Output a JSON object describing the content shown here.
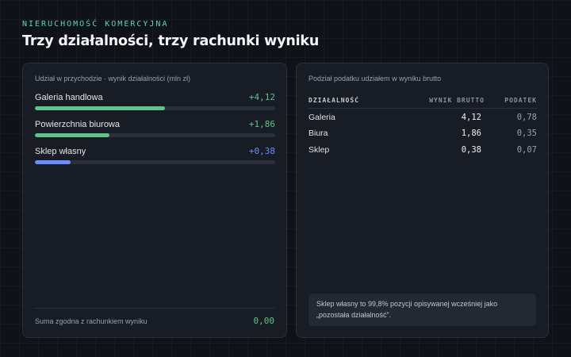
{
  "header": {
    "eyebrow": "NIERUCHOMOŚĆ KOMERCYJNA",
    "title": "Trzy działalności, trzy rachunki wyniku"
  },
  "left_panel": {
    "caption": "Udział w przychodzie · wynik działalności (mln zł)",
    "bars": [
      {
        "label": "Galeria handlowa",
        "value_text": "+4,12",
        "share": 0.54,
        "color": "#5fc48a"
      },
      {
        "label": "Powierzchnia biurowa",
        "value_text": "+1,86",
        "share": 0.31,
        "color": "#5fc48a"
      },
      {
        "label": "Sklep własny",
        "value_text": "+0,38",
        "share": 0.15,
        "color": "#6b8cff"
      }
    ],
    "sum_label": "Suma zgodna z rachunkiem wyniku",
    "sum_value": "0,00"
  },
  "right_panel": {
    "caption": "Podział podatku udziałem w wyniku brutto",
    "columns": [
      "DZIAŁALNOŚĆ",
      "WYNIK BRUTTO",
      "PODATEK"
    ],
    "rows": [
      {
        "name": "Galeria",
        "gross": "4,12",
        "tax": "0,78"
      },
      {
        "name": "Biura",
        "gross": "1,86",
        "tax": "0,35"
      },
      {
        "name": "Sklep",
        "gross": "0,38",
        "tax": "0,07"
      }
    ],
    "note": "Sklep własny to 99,8% pozycji opisywanej wcześniej jako „pozostała działalność”."
  }
}
